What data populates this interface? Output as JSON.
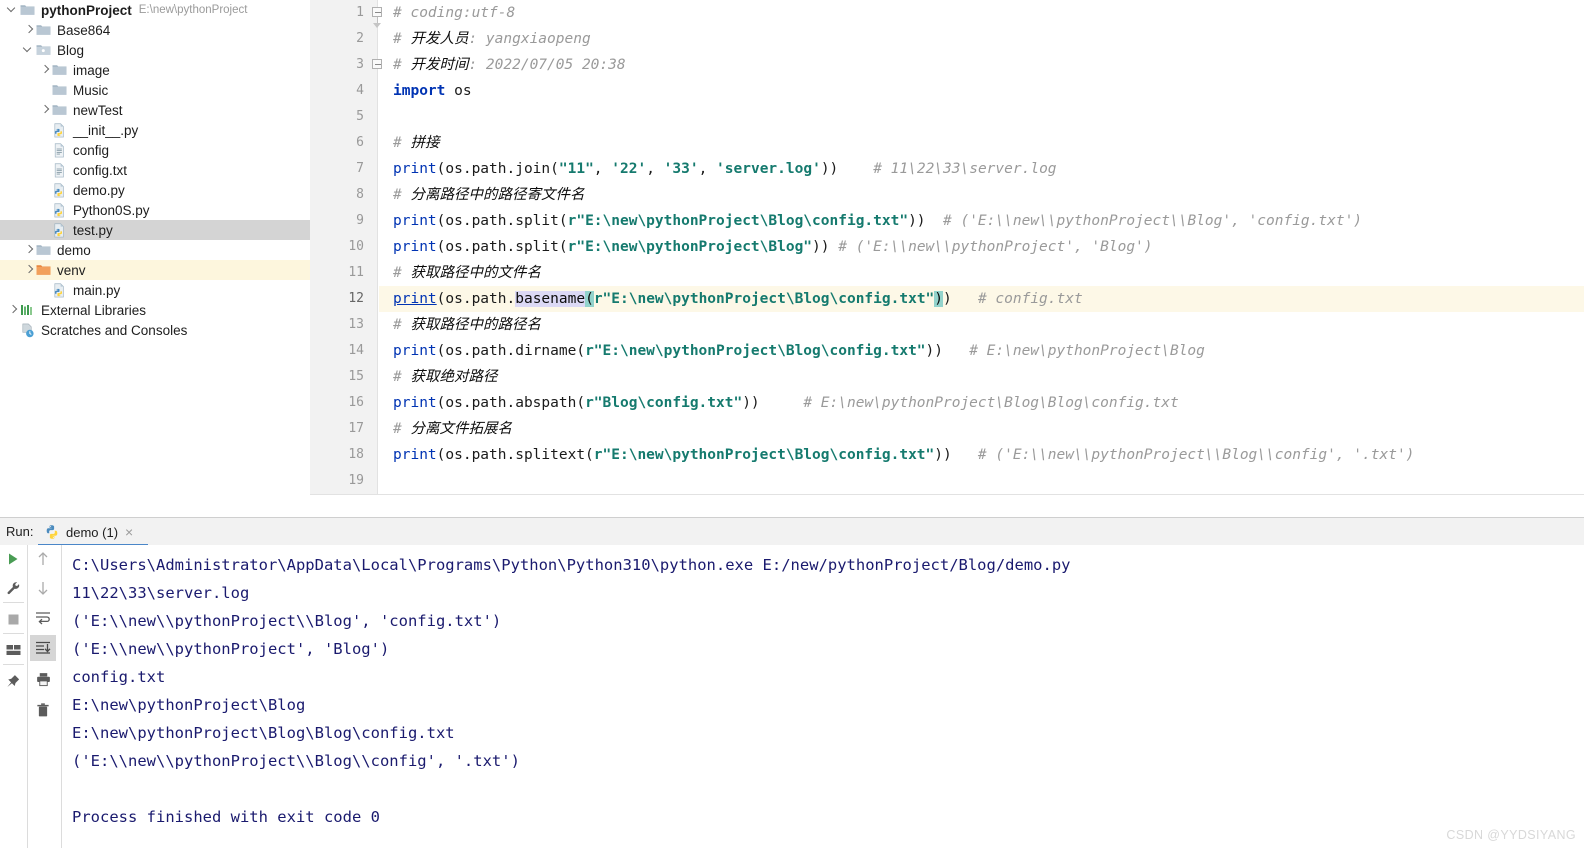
{
  "project_tree": {
    "name": "project-tree",
    "items": [
      {
        "depth": 0,
        "arrow": "down",
        "icon": "folder-icon",
        "label": "pythonProject",
        "bold": true,
        "path": "E:\\new\\pythonProject",
        "state": "normal"
      },
      {
        "depth": 1,
        "arrow": "right",
        "icon": "folder-icon",
        "label": "Base864",
        "bold": false,
        "path": "",
        "state": "normal"
      },
      {
        "depth": 1,
        "arrow": "down",
        "icon": "folder-open-icon",
        "label": "Blog",
        "bold": false,
        "path": "",
        "state": "normal"
      },
      {
        "depth": 2,
        "arrow": "right",
        "icon": "folder-icon",
        "label": "image",
        "bold": false,
        "path": "",
        "state": "normal"
      },
      {
        "depth": 2,
        "arrow": "none",
        "icon": "folder-icon",
        "label": "Music",
        "bold": false,
        "path": "",
        "state": "normal"
      },
      {
        "depth": 2,
        "arrow": "right",
        "icon": "folder-icon",
        "label": "newTest",
        "bold": false,
        "path": "",
        "state": "normal"
      },
      {
        "depth": 2,
        "arrow": "none",
        "icon": "python-file-icon",
        "label": "__init__.py",
        "bold": false,
        "path": "",
        "state": "normal"
      },
      {
        "depth": 2,
        "arrow": "none",
        "icon": "text-file-icon",
        "label": "config",
        "bold": false,
        "path": "",
        "state": "normal"
      },
      {
        "depth": 2,
        "arrow": "none",
        "icon": "text-file-icon",
        "label": "config.txt",
        "bold": false,
        "path": "",
        "state": "normal"
      },
      {
        "depth": 2,
        "arrow": "none",
        "icon": "python-file-icon",
        "label": "demo.py",
        "bold": false,
        "path": "",
        "state": "normal"
      },
      {
        "depth": 2,
        "arrow": "none",
        "icon": "python-file-icon",
        "label": "Python0S.py",
        "bold": false,
        "path": "",
        "state": "normal"
      },
      {
        "depth": 2,
        "arrow": "none",
        "icon": "python-file-icon",
        "label": "test.py",
        "bold": false,
        "path": "",
        "state": "selected"
      },
      {
        "depth": 1,
        "arrow": "right",
        "icon": "folder-icon",
        "label": "demo",
        "bold": false,
        "path": "",
        "state": "normal"
      },
      {
        "depth": 1,
        "arrow": "right",
        "icon": "folder-orange-icon",
        "label": "venv",
        "bold": false,
        "path": "",
        "state": "highlighted"
      },
      {
        "depth": 2,
        "arrow": "none",
        "icon": "python-file-icon",
        "label": "main.py",
        "bold": false,
        "path": "",
        "state": "normal"
      },
      {
        "depth": 0,
        "arrow": "right",
        "icon": "libraries-icon",
        "label": "External Libraries",
        "bold": false,
        "path": "",
        "state": "normal"
      },
      {
        "depth": 0,
        "arrow": "none",
        "icon": "scratches-icon",
        "label": "Scratches and Consoles",
        "bold": false,
        "path": "",
        "state": "normal"
      }
    ]
  },
  "editor": {
    "name": "code-editor",
    "current_line": 12,
    "line_numbers": [
      "1",
      "2",
      "3",
      "4",
      "5",
      "6",
      "7",
      "8",
      "9",
      "10",
      "11",
      "12",
      "13",
      "14",
      "15",
      "16",
      "17",
      "18",
      "19"
    ],
    "lines": [
      {
        "n": 1,
        "segments": [
          {
            "t": "# coding:utf-8",
            "c": "cmt"
          }
        ]
      },
      {
        "n": 2,
        "segments": [
          {
            "t": "# ",
            "c": "cmt"
          },
          {
            "t": "开发人员",
            "c": "cmt-cn"
          },
          {
            "t": ": yangxiaopeng",
            "c": "cmt"
          }
        ]
      },
      {
        "n": 3,
        "segments": [
          {
            "t": "# ",
            "c": "cmt"
          },
          {
            "t": "开发时间",
            "c": "cmt-cn"
          },
          {
            "t": ": 2022/07/05 20:38",
            "c": "cmt"
          }
        ]
      },
      {
        "n": 4,
        "segments": [
          {
            "t": "import",
            "c": "kw"
          },
          {
            "t": " os",
            "c": "pn"
          }
        ]
      },
      {
        "n": 5,
        "segments": []
      },
      {
        "n": 6,
        "segments": [
          {
            "t": "# ",
            "c": "cmt"
          },
          {
            "t": "拼接",
            "c": "cmt-cn"
          }
        ]
      },
      {
        "n": 7,
        "segments": [
          {
            "t": "print",
            "c": "fn"
          },
          {
            "t": "(os.path.join(",
            "c": "pn"
          },
          {
            "t": "\"11\"",
            "c": "strt"
          },
          {
            "t": ", ",
            "c": "pn"
          },
          {
            "t": "'22'",
            "c": "strt"
          },
          {
            "t": ", ",
            "c": "pn"
          },
          {
            "t": "'33'",
            "c": "strt"
          },
          {
            "t": ", ",
            "c": "pn"
          },
          {
            "t": "'server.log'",
            "c": "strt"
          },
          {
            "t": "))",
            "c": "pn"
          },
          {
            "t": "    # 11\\22\\33\\server.log",
            "c": "cmt"
          }
        ]
      },
      {
        "n": 8,
        "segments": [
          {
            "t": "# ",
            "c": "cmt"
          },
          {
            "t": "分离路径中的路径寄文件名",
            "c": "cmt-cn"
          }
        ]
      },
      {
        "n": 9,
        "segments": [
          {
            "t": "print",
            "c": "fn"
          },
          {
            "t": "(os.path.split(",
            "c": "pn"
          },
          {
            "t": "r\"E:\\new\\pythonProject\\Blog\\config.txt\"",
            "c": "strt"
          },
          {
            "t": "))",
            "c": "pn"
          },
          {
            "t": "  # ('E:\\\\new\\\\pythonProject\\\\Blog', 'config.txt')",
            "c": "cmt"
          }
        ]
      },
      {
        "n": 10,
        "segments": [
          {
            "t": "print",
            "c": "fn"
          },
          {
            "t": "(os.path.split(",
            "c": "pn"
          },
          {
            "t": "r\"E:\\new\\pythonProject\\Blog\"",
            "c": "strt"
          },
          {
            "t": "))",
            "c": "pn"
          },
          {
            "t": " # ('E:\\\\new\\\\pythonProject', 'Blog')",
            "c": "cmt"
          }
        ]
      },
      {
        "n": 11,
        "segments": [
          {
            "t": "# ",
            "c": "cmt"
          },
          {
            "t": "获取路径中的文件名",
            "c": "cmt-cn"
          }
        ]
      },
      {
        "n": 12,
        "segments": [
          {
            "t": "print",
            "c": "fn-u"
          },
          {
            "t": "(os.path.",
            "c": "pn"
          },
          {
            "t": "basename",
            "c": "idsel"
          },
          {
            "t": "(",
            "c": "caret-hl"
          },
          {
            "t": "r\"E:\\new\\pythonProject\\Blog\\config.txt\"",
            "c": "strt"
          },
          {
            "t": ")",
            "c": "caret-hl"
          },
          {
            "t": ")",
            "c": "pn"
          },
          {
            "t": "   # config.txt",
            "c": "cmt"
          }
        ]
      },
      {
        "n": 13,
        "segments": [
          {
            "t": "# ",
            "c": "cmt"
          },
          {
            "t": "获取路径中的路径名",
            "c": "cmt-cn"
          }
        ]
      },
      {
        "n": 14,
        "segments": [
          {
            "t": "print",
            "c": "fn"
          },
          {
            "t": "(os.path.dirname(",
            "c": "pn"
          },
          {
            "t": "r\"E:\\new\\pythonProject\\Blog\\config.txt\"",
            "c": "strt"
          },
          {
            "t": "))",
            "c": "pn"
          },
          {
            "t": "   # E:\\new\\pythonProject\\Blog",
            "c": "cmt"
          }
        ]
      },
      {
        "n": 15,
        "segments": [
          {
            "t": "# ",
            "c": "cmt"
          },
          {
            "t": "获取绝对路径",
            "c": "cmt-cn"
          }
        ]
      },
      {
        "n": 16,
        "segments": [
          {
            "t": "print",
            "c": "fn"
          },
          {
            "t": "(os.path.abspath(",
            "c": "pn"
          },
          {
            "t": "r\"Blog\\config.txt\"",
            "c": "strt"
          },
          {
            "t": "))",
            "c": "pn"
          },
          {
            "t": "     # E:\\new\\pythonProject\\Blog\\Blog\\config.txt",
            "c": "cmt"
          }
        ]
      },
      {
        "n": 17,
        "segments": [
          {
            "t": "# ",
            "c": "cmt"
          },
          {
            "t": "分离文件拓展名",
            "c": "cmt-cn"
          }
        ]
      },
      {
        "n": 18,
        "segments": [
          {
            "t": "print",
            "c": "fn"
          },
          {
            "t": "(os.path.splitext(",
            "c": "pn"
          },
          {
            "t": "r\"E:\\new\\pythonProject\\Blog\\config.txt\"",
            "c": "strt"
          },
          {
            "t": "))",
            "c": "pn"
          },
          {
            "t": "   # ('E:\\\\new\\\\pythonProject\\\\Blog\\\\config', '.txt')",
            "c": "cmt"
          }
        ]
      },
      {
        "n": 19,
        "segments": []
      }
    ],
    "fold_markers": [
      1,
      3
    ]
  },
  "run_panel": {
    "name": "run-tool-window",
    "label": "Run:",
    "tab": {
      "title": "demo (1)",
      "close": "×"
    },
    "toolbar_left": [
      {
        "name": "rerun-button",
        "icon": "play-icon"
      },
      {
        "name": "configure-button",
        "icon": "wrench-icon"
      },
      {
        "name": "stop-button",
        "icon": "stop-icon"
      },
      {
        "name": "layout-button",
        "icon": "layout-icon"
      },
      {
        "name": "pin-tab-button",
        "icon": "pin-icon"
      }
    ],
    "toolbar_right": [
      {
        "name": "up-stack-button",
        "icon": "arrow-up-icon"
      },
      {
        "name": "down-stack-button",
        "icon": "arrow-down-icon"
      },
      {
        "name": "soft-wrap-button",
        "icon": "wrap-icon"
      },
      {
        "name": "scroll-to-end-button",
        "icon": "scroll-end-icon",
        "active": true
      },
      {
        "name": "print-button",
        "icon": "printer-icon"
      },
      {
        "name": "clear-all-button",
        "icon": "trash-icon"
      }
    ],
    "console_lines": [
      "C:\\Users\\Administrator\\AppData\\Local\\Programs\\Python\\Python310\\python.exe E:/new/pythonProject/Blog/demo.py",
      "11\\22\\33\\server.log",
      "('E:\\\\new\\\\pythonProject\\\\Blog', 'config.txt')",
      "('E:\\\\new\\\\pythonProject', 'Blog')",
      "config.txt",
      "E:\\new\\pythonProject\\Blog",
      "E:\\new\\pythonProject\\Blog\\Blog\\config.txt",
      "('E:\\\\new\\\\pythonProject\\\\Blog\\\\config', '.txt')",
      "",
      "Process finished with exit code 0"
    ]
  },
  "watermark": {
    "text": "CSDN @YYDSIYANG"
  },
  "colors": {
    "keyword": "#0033b3",
    "string": "#157a6e",
    "comment": "#9a9a9a",
    "console_text": "#1a1a6e",
    "selection_row": "#d4d4d4",
    "highlight_row": "#fdf6dd",
    "current_line": "#fdf8e7",
    "tab_underline": "#4a86c8",
    "identifier_select": "#dcd9f5",
    "caret_match": "#93d3cc"
  }
}
